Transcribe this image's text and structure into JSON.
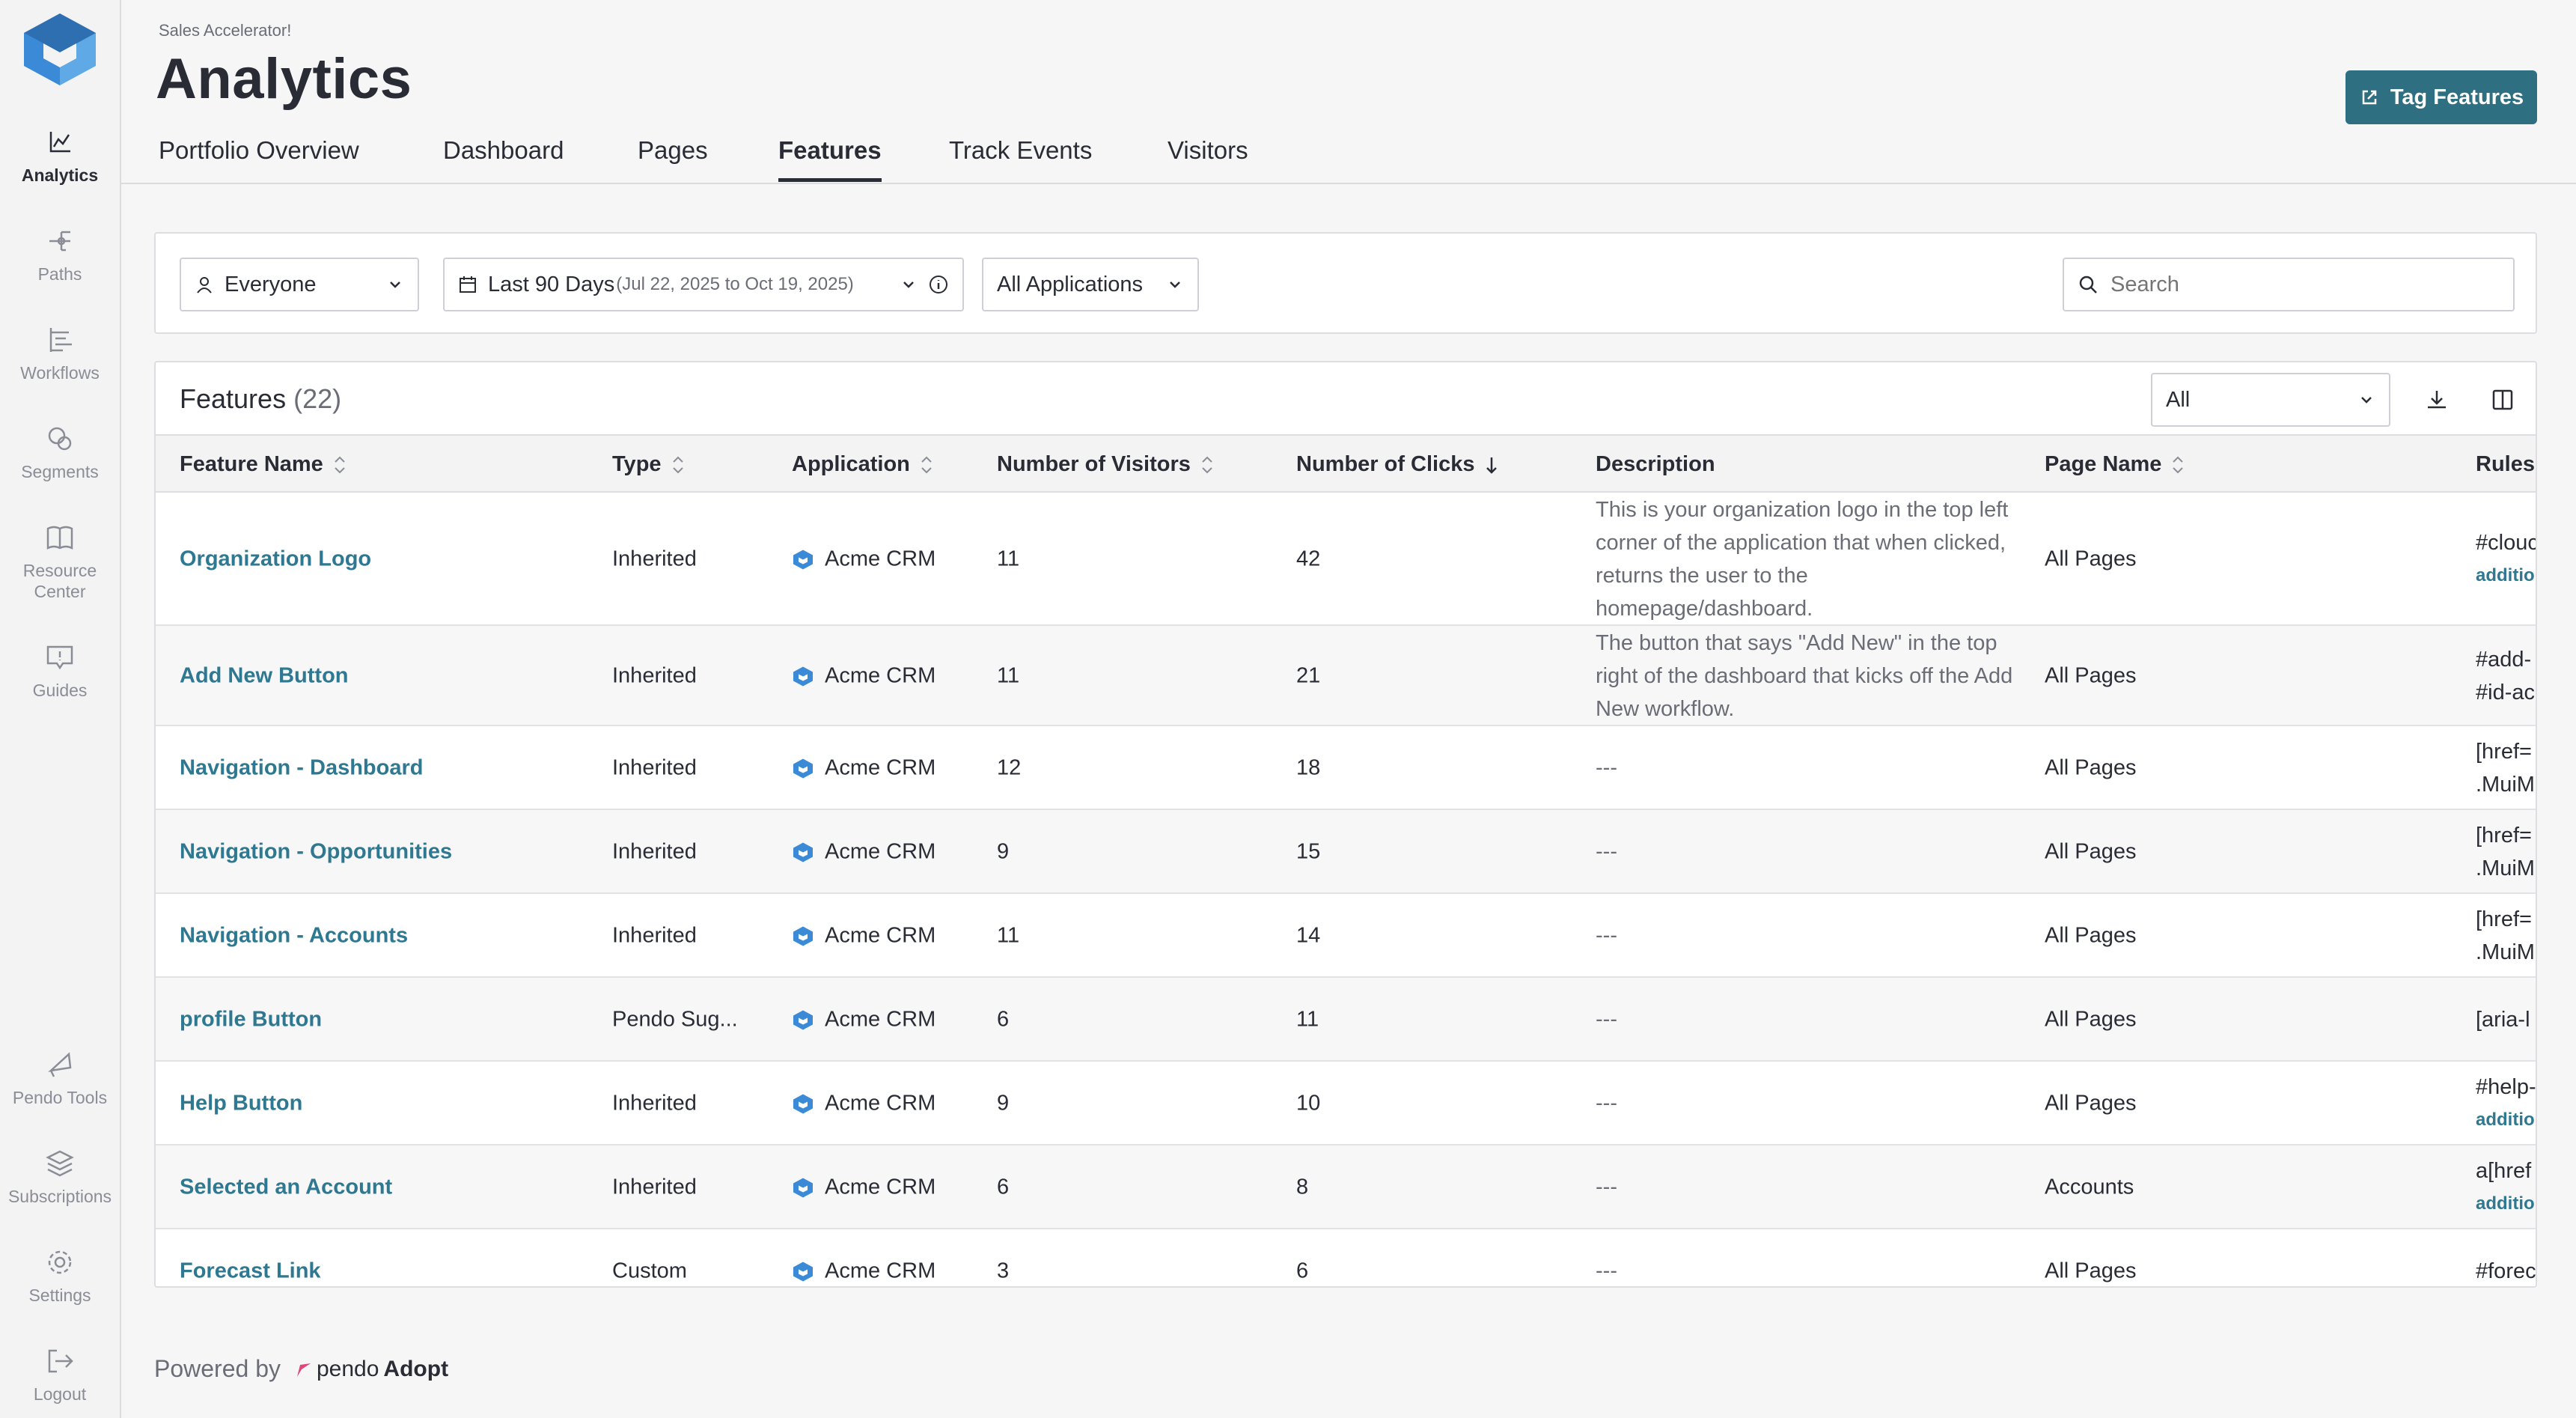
{
  "sidebar": {
    "items": [
      {
        "label": "Analytics",
        "icon": "chart-line-icon",
        "active": true
      },
      {
        "label": "Paths",
        "icon": "paths-icon"
      },
      {
        "label": "Workflows",
        "icon": "workflows-icon"
      },
      {
        "label": "Segments",
        "icon": "segments-icon"
      },
      {
        "label": "Resource Center",
        "icon": "book-icon"
      },
      {
        "label": "Guides",
        "icon": "guides-icon"
      },
      {
        "label": "Pendo Tools",
        "icon": "pendo-tools-icon"
      },
      {
        "label": "Subscriptions",
        "icon": "layers-icon"
      },
      {
        "label": "Settings",
        "icon": "gear-icon"
      },
      {
        "label": "Logout",
        "icon": "logout-icon"
      }
    ]
  },
  "header": {
    "breadcrumb": "Sales Accelerator!",
    "title": "Analytics",
    "tag_button": "Tag Features"
  },
  "tabs": [
    {
      "label": "Portfolio Overview"
    },
    {
      "label": "Dashboard"
    },
    {
      "label": "Pages"
    },
    {
      "label": "Features",
      "active": true
    },
    {
      "label": "Track Events"
    },
    {
      "label": "Visitors"
    }
  ],
  "filters": {
    "segment": "Everyone",
    "date_range": "Last 90 Days",
    "date_detail": "(Jul 22, 2025 to Oct 19, 2025)",
    "applications": "All Applications",
    "search_placeholder": "Search"
  },
  "table": {
    "title": "Features",
    "count": "(22)",
    "filter_value": "All",
    "columns": [
      "Feature Name",
      "Type",
      "Application",
      "Number of Visitors",
      "Number of Clicks",
      "Description",
      "Page Name",
      "Rules"
    ],
    "rows": [
      {
        "name": "Organization Logo",
        "type": "Inherited",
        "app": "Acme CRM",
        "visitors": "11",
        "clicks": "42",
        "description": "This is your organization logo in the top left corner of the application that when clicked, returns the user to the homepage/dashboard.",
        "page": "All Pages",
        "rules": [
          "#clouc"
        ],
        "rules_more": "additio"
      },
      {
        "name": "Add New Button",
        "type": "Inherited",
        "app": "Acme CRM",
        "visitors": "11",
        "clicks": "21",
        "description": "The button that says \"Add New\" in the top right of the dashboard that kicks off the Add New workflow.",
        "page": "All Pages",
        "rules": [
          "#add-",
          "#id-ac"
        ],
        "rules_more": ""
      },
      {
        "name": "Navigation - Dashboard",
        "type": "Inherited",
        "app": "Acme CRM",
        "visitors": "12",
        "clicks": "18",
        "description": "---",
        "page": "All Pages",
        "rules": [
          "[href=",
          ".MuiM"
        ],
        "rules_more": ""
      },
      {
        "name": "Navigation - Opportunities",
        "type": "Inherited",
        "app": "Acme CRM",
        "visitors": "9",
        "clicks": "15",
        "description": "---",
        "page": "All Pages",
        "rules": [
          "[href=",
          ".MuiM"
        ],
        "rules_more": ""
      },
      {
        "name": "Navigation - Accounts",
        "type": "Inherited",
        "app": "Acme CRM",
        "visitors": "11",
        "clicks": "14",
        "description": "---",
        "page": "All Pages",
        "rules": [
          "[href=",
          ".MuiM"
        ],
        "rules_more": ""
      },
      {
        "name": "profile Button",
        "type": "Pendo Sug...",
        "app": "Acme CRM",
        "visitors": "6",
        "clicks": "11",
        "description": "---",
        "page": "All Pages",
        "rules": [
          "[aria-l"
        ],
        "rules_more": ""
      },
      {
        "name": "Help Button",
        "type": "Inherited",
        "app": "Acme CRM",
        "visitors": "9",
        "clicks": "10",
        "description": "---",
        "page": "All Pages",
        "rules": [
          "#help-"
        ],
        "rules_more": "additio"
      },
      {
        "name": "Selected an Account",
        "type": "Inherited",
        "app": "Acme CRM",
        "visitors": "6",
        "clicks": "8",
        "description": "---",
        "page": "Accounts",
        "rules": [
          "a[href"
        ],
        "rules_more": "additio"
      },
      {
        "name": "Forecast Link",
        "type": "Custom",
        "app": "Acme CRM",
        "visitors": "3",
        "clicks": "6",
        "description": "---",
        "page": "All Pages",
        "rules": [
          "#forec"
        ],
        "rules_more": ""
      }
    ]
  },
  "footer": {
    "powered_by": "Powered by",
    "brand": "pendo",
    "product": "Adopt"
  },
  "colors": {
    "accent": "#2f6f82",
    "link": "#2f7891",
    "text": "#2a2c35",
    "muted": "#6b6d76"
  }
}
